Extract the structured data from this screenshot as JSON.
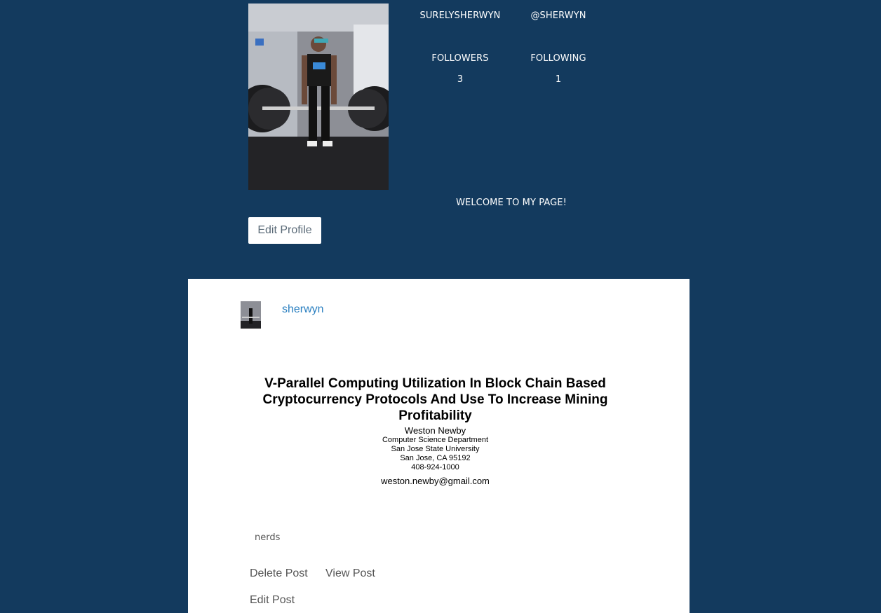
{
  "profile": {
    "photo_alt": "profile-photo",
    "username": "SURELYSHERWYN",
    "handle": "@SHERWYN",
    "followers_label": "FOLLOWERS",
    "followers_count": "3",
    "following_label": "FOLLOWING",
    "following_count": "1",
    "bio": "WELCOME TO MY PAGE!",
    "edit_button": "Edit Profile"
  },
  "post": {
    "author": "sherwyn",
    "image": {
      "title_lines": [
        "V-Parallel Computing Utilization In Block Chain Based",
        "Cryptocurrency Protocols And Use To Increase Mining",
        "Profitability"
      ],
      "author": "Weston Newby",
      "affiliation_lines": [
        "Computer Science Department",
        "San Jose State University",
        "San Jose, CA 95192",
        "408-924-1000"
      ],
      "email": "weston.newby@gmail.com"
    },
    "tag": "nerds",
    "actions": {
      "delete": "Delete Post",
      "view": "View Post",
      "edit": "Edit Post"
    }
  },
  "colors": {
    "page_bg": "#133a5e",
    "card_bg": "#ffffff",
    "link": "#2a7fc0"
  }
}
